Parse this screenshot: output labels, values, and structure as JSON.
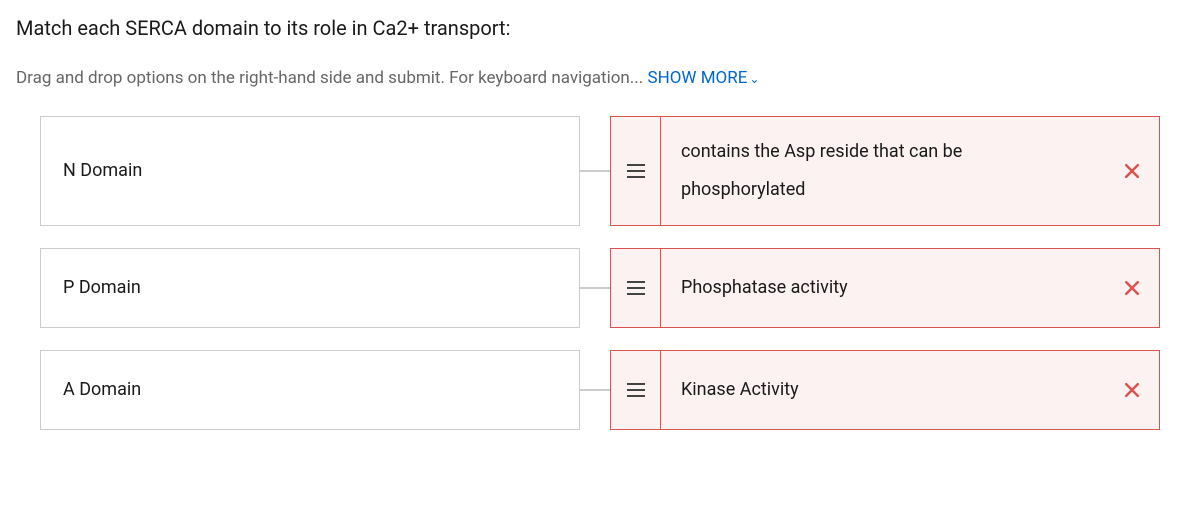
{
  "question": {
    "title": "Match each SERCA domain to its role in Ca2+ transport:",
    "instructions_prefix": "Drag and drop options on the right-hand side and submit. For keyboard navigation... ",
    "show_more_label": "SHOW MORE"
  },
  "rows": [
    {
      "prompt": "N Domain",
      "answer": "contains the Asp reside that can be phosphorylated",
      "status": "incorrect"
    },
    {
      "prompt": "P Domain",
      "answer": "Phosphatase activity",
      "status": "incorrect"
    },
    {
      "prompt": "A Domain",
      "answer": "Kinase Activity",
      "status": "incorrect"
    }
  ]
}
